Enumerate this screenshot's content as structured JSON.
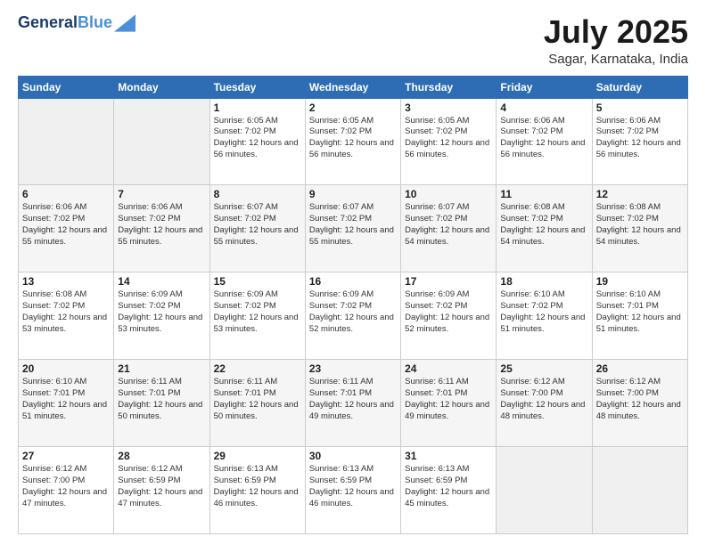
{
  "header": {
    "logo_line1": "General",
    "logo_line2": "Blue",
    "month_year": "July 2025",
    "location": "Sagar, Karnataka, India"
  },
  "weekdays": [
    "Sunday",
    "Monday",
    "Tuesday",
    "Wednesday",
    "Thursday",
    "Friday",
    "Saturday"
  ],
  "weeks": [
    [
      {
        "day": "",
        "info": ""
      },
      {
        "day": "",
        "info": ""
      },
      {
        "day": "1",
        "info": "Sunrise: 6:05 AM\nSunset: 7:02 PM\nDaylight: 12 hours and 56 minutes."
      },
      {
        "day": "2",
        "info": "Sunrise: 6:05 AM\nSunset: 7:02 PM\nDaylight: 12 hours and 56 minutes."
      },
      {
        "day": "3",
        "info": "Sunrise: 6:05 AM\nSunset: 7:02 PM\nDaylight: 12 hours and 56 minutes."
      },
      {
        "day": "4",
        "info": "Sunrise: 6:06 AM\nSunset: 7:02 PM\nDaylight: 12 hours and 56 minutes."
      },
      {
        "day": "5",
        "info": "Sunrise: 6:06 AM\nSunset: 7:02 PM\nDaylight: 12 hours and 56 minutes."
      }
    ],
    [
      {
        "day": "6",
        "info": "Sunrise: 6:06 AM\nSunset: 7:02 PM\nDaylight: 12 hours and 55 minutes."
      },
      {
        "day": "7",
        "info": "Sunrise: 6:06 AM\nSunset: 7:02 PM\nDaylight: 12 hours and 55 minutes."
      },
      {
        "day": "8",
        "info": "Sunrise: 6:07 AM\nSunset: 7:02 PM\nDaylight: 12 hours and 55 minutes."
      },
      {
        "day": "9",
        "info": "Sunrise: 6:07 AM\nSunset: 7:02 PM\nDaylight: 12 hours and 55 minutes."
      },
      {
        "day": "10",
        "info": "Sunrise: 6:07 AM\nSunset: 7:02 PM\nDaylight: 12 hours and 54 minutes."
      },
      {
        "day": "11",
        "info": "Sunrise: 6:08 AM\nSunset: 7:02 PM\nDaylight: 12 hours and 54 minutes."
      },
      {
        "day": "12",
        "info": "Sunrise: 6:08 AM\nSunset: 7:02 PM\nDaylight: 12 hours and 54 minutes."
      }
    ],
    [
      {
        "day": "13",
        "info": "Sunrise: 6:08 AM\nSunset: 7:02 PM\nDaylight: 12 hours and 53 minutes."
      },
      {
        "day": "14",
        "info": "Sunrise: 6:09 AM\nSunset: 7:02 PM\nDaylight: 12 hours and 53 minutes."
      },
      {
        "day": "15",
        "info": "Sunrise: 6:09 AM\nSunset: 7:02 PM\nDaylight: 12 hours and 53 minutes."
      },
      {
        "day": "16",
        "info": "Sunrise: 6:09 AM\nSunset: 7:02 PM\nDaylight: 12 hours and 52 minutes."
      },
      {
        "day": "17",
        "info": "Sunrise: 6:09 AM\nSunset: 7:02 PM\nDaylight: 12 hours and 52 minutes."
      },
      {
        "day": "18",
        "info": "Sunrise: 6:10 AM\nSunset: 7:02 PM\nDaylight: 12 hours and 51 minutes."
      },
      {
        "day": "19",
        "info": "Sunrise: 6:10 AM\nSunset: 7:01 PM\nDaylight: 12 hours and 51 minutes."
      }
    ],
    [
      {
        "day": "20",
        "info": "Sunrise: 6:10 AM\nSunset: 7:01 PM\nDaylight: 12 hours and 51 minutes."
      },
      {
        "day": "21",
        "info": "Sunrise: 6:11 AM\nSunset: 7:01 PM\nDaylight: 12 hours and 50 minutes."
      },
      {
        "day": "22",
        "info": "Sunrise: 6:11 AM\nSunset: 7:01 PM\nDaylight: 12 hours and 50 minutes."
      },
      {
        "day": "23",
        "info": "Sunrise: 6:11 AM\nSunset: 7:01 PM\nDaylight: 12 hours and 49 minutes."
      },
      {
        "day": "24",
        "info": "Sunrise: 6:11 AM\nSunset: 7:01 PM\nDaylight: 12 hours and 49 minutes."
      },
      {
        "day": "25",
        "info": "Sunrise: 6:12 AM\nSunset: 7:00 PM\nDaylight: 12 hours and 48 minutes."
      },
      {
        "day": "26",
        "info": "Sunrise: 6:12 AM\nSunset: 7:00 PM\nDaylight: 12 hours and 48 minutes."
      }
    ],
    [
      {
        "day": "27",
        "info": "Sunrise: 6:12 AM\nSunset: 7:00 PM\nDaylight: 12 hours and 47 minutes."
      },
      {
        "day": "28",
        "info": "Sunrise: 6:12 AM\nSunset: 6:59 PM\nDaylight: 12 hours and 47 minutes."
      },
      {
        "day": "29",
        "info": "Sunrise: 6:13 AM\nSunset: 6:59 PM\nDaylight: 12 hours and 46 minutes."
      },
      {
        "day": "30",
        "info": "Sunrise: 6:13 AM\nSunset: 6:59 PM\nDaylight: 12 hours and 46 minutes."
      },
      {
        "day": "31",
        "info": "Sunrise: 6:13 AM\nSunset: 6:59 PM\nDaylight: 12 hours and 45 minutes."
      },
      {
        "day": "",
        "info": ""
      },
      {
        "day": "",
        "info": ""
      }
    ]
  ]
}
